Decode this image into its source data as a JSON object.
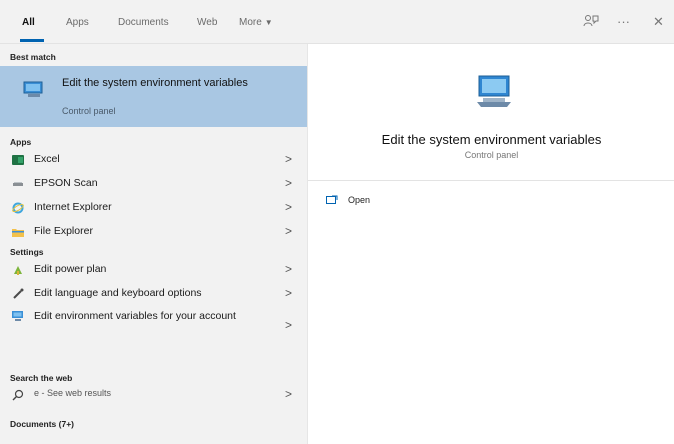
{
  "header": {
    "tabs": [
      {
        "label": "All"
      },
      {
        "label": "Apps"
      },
      {
        "label": "Documents"
      },
      {
        "label": "Web"
      },
      {
        "label": "More"
      }
    ],
    "more_arrow": "▼",
    "feedback_icon": "feedback-icon",
    "ellipsis": "···",
    "close": "✕"
  },
  "left": {
    "best_match_heading": "Best match",
    "best_match": {
      "title": "Edit the system environment variables",
      "subtitle": "Control panel",
      "icon": "monitor-icon"
    },
    "apps_heading": "Apps",
    "apps": [
      {
        "label": "Excel",
        "icon": "excel-icon"
      },
      {
        "label": "EPSON Scan",
        "icon": "epson-scan-icon"
      },
      {
        "label": "Internet Explorer",
        "icon": "internet-explorer-icon"
      },
      {
        "label": "File Explorer",
        "icon": "file-explorer-icon"
      }
    ],
    "settings_heading": "Settings",
    "settings": [
      {
        "label": "Edit power plan",
        "icon": "power-plan-icon"
      },
      {
        "label": "Edit language and keyboard options",
        "icon": "language-icon"
      },
      {
        "label": "Edit environment variables for your account",
        "icon": "monitor-icon"
      }
    ],
    "web_heading": "Search the web",
    "web": {
      "label": "e - See web results",
      "icon": "search-icon"
    },
    "documents_heading": "Documents (7+)",
    "chevron": ">"
  },
  "right": {
    "title": "Edit the system environment variables",
    "subtitle": "Control panel",
    "action_open": "Open"
  },
  "colors": {
    "accent": "#0063b1",
    "selected_bg": "#a9c7e3",
    "panel_bg": "#f2f2f2"
  }
}
